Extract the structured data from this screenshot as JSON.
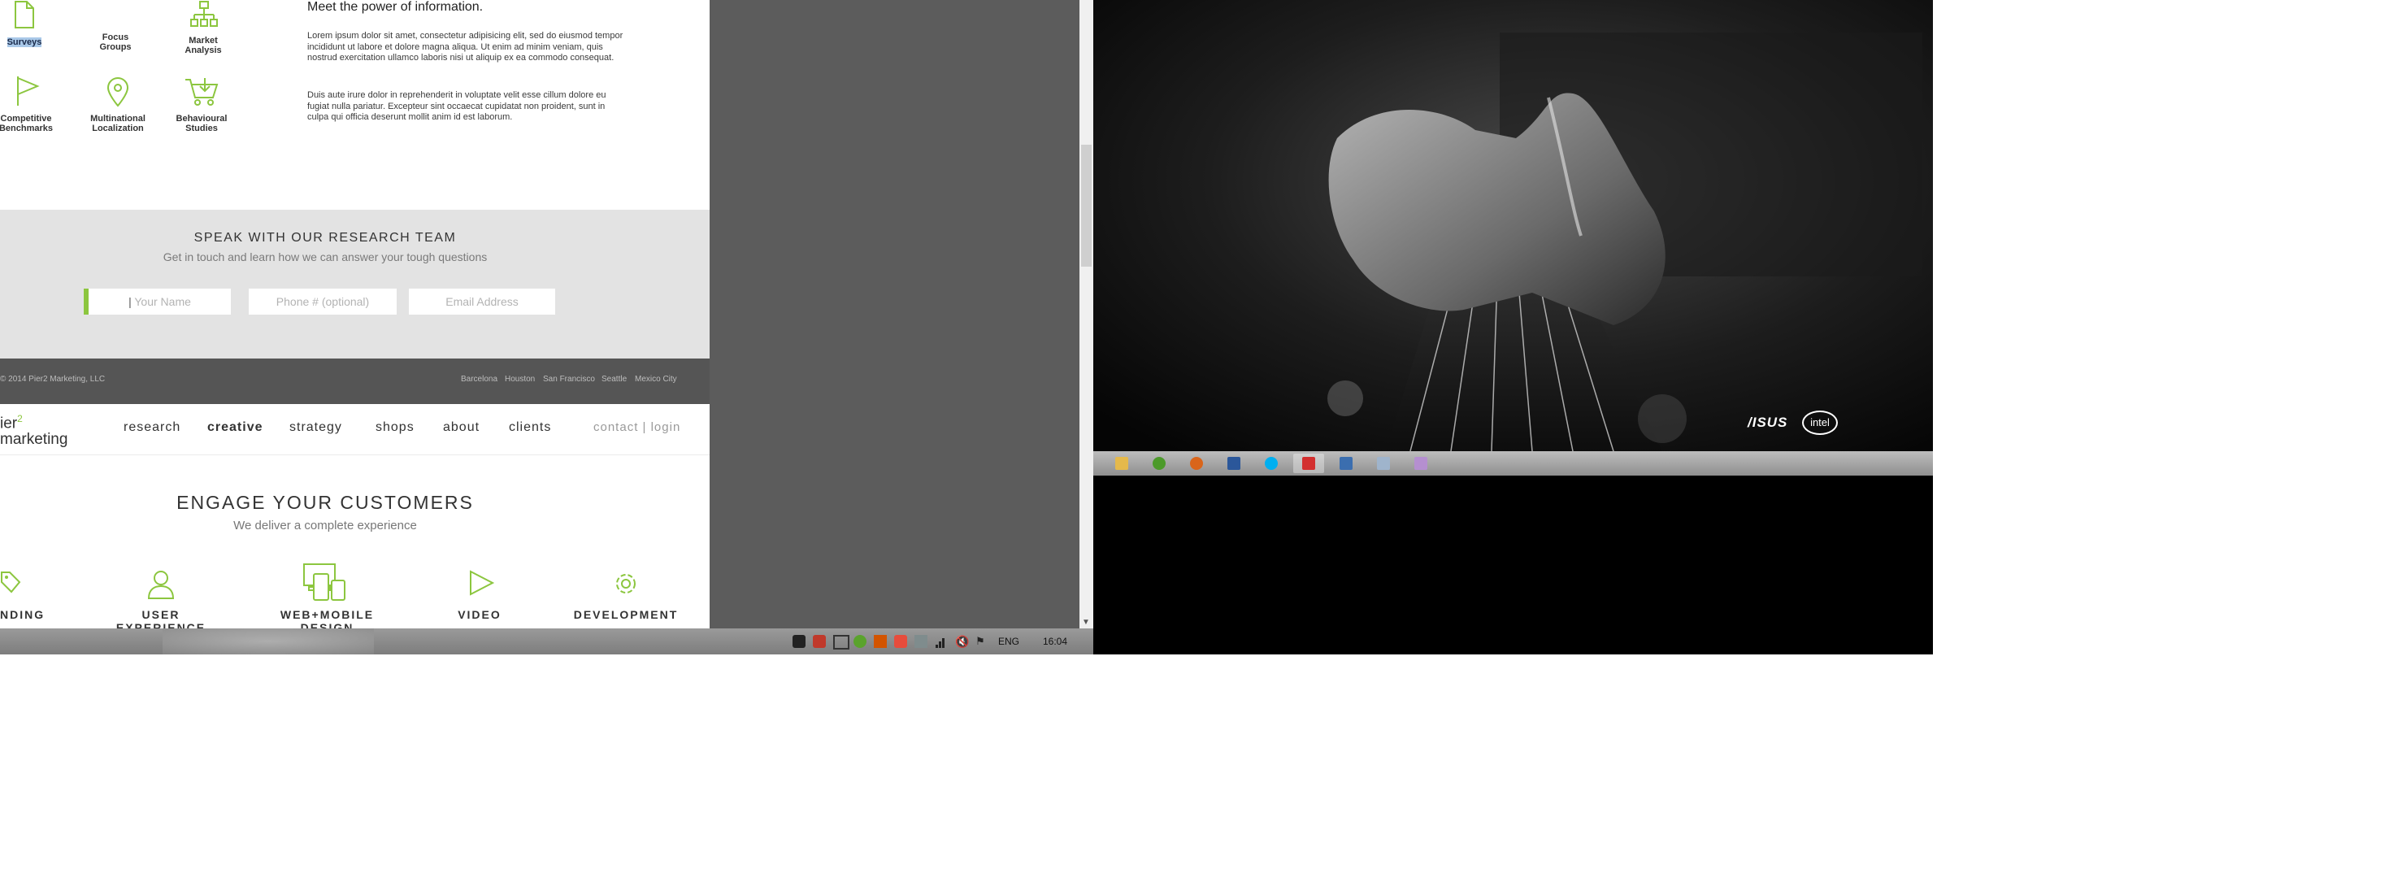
{
  "services": {
    "items": [
      {
        "label": "Surveys"
      },
      {
        "label": "Focus Groups"
      },
      {
        "label": "Market Analysis"
      },
      {
        "label": "Competitive Benchmarks"
      },
      {
        "label": "Multinational Localization"
      },
      {
        "label": "Behavioural Studies"
      }
    ],
    "heading": "Meet the power of information.",
    "paragraph1": "Lorem ipsum dolor sit amet, consectetur adipisicing elit, sed do eiusmod tempor incididunt ut labore et dolore magna aliqua. Ut enim ad minim veniam, quis nostrud exercitation ullamco laboris nisi ut aliquip ex ea commodo consequat.",
    "paragraph2": "Duis aute irure dolor in reprehenderit in voluptate velit esse cillum dolore eu fugiat nulla pariatur. Excepteur sint occaecat cupidatat non proident, sunt in culpa qui officia deserunt mollit anim id est laborum."
  },
  "contact": {
    "title": "SPEAK WITH OUR RESEARCH TEAM",
    "subtitle": "Get in touch and learn how we can answer your tough questions",
    "name_placeholder": "Your Name",
    "phone_placeholder": "Phone # (optional)",
    "email_placeholder": "Email Address"
  },
  "footer": {
    "copyright": "© 2014 Pier2 Marketing, LLC",
    "cities": [
      "Barcelona",
      "Houston",
      "San Francisco",
      "Seattle",
      "Mexico City"
    ]
  },
  "nav": {
    "logo_line1": "ier",
    "logo_super": "2",
    "logo_line2": "marketing",
    "items": [
      "research",
      "creative",
      "strategy",
      "shops",
      "about",
      "clients"
    ],
    "contact_login": "contact | login"
  },
  "engage": {
    "title": "ENGAGE YOUR CUSTOMERS",
    "subtitle": "We deliver a complete experience",
    "features": [
      "NDING",
      "USER EXPERIENCE",
      "WEB+MOBILE DESIGN",
      "VIDEO",
      "DEVELOPMENT"
    ]
  },
  "tray": {
    "language": "ENG",
    "time": "16:04"
  },
  "wallpaper": {
    "logos": [
      "/ISUS",
      "intel"
    ]
  },
  "taskbar_icons": [
    "file-explorer-icon",
    "evernote-icon",
    "firefox-icon",
    "word-icon",
    "skype-icon",
    "acrobat-icon",
    "virtualbox-icon",
    "notepad-icon",
    "paint-icon"
  ],
  "colors": {
    "accent_green": "#8cc63f",
    "footer_gray": "#555555",
    "contact_band": "#e3e3e3"
  }
}
